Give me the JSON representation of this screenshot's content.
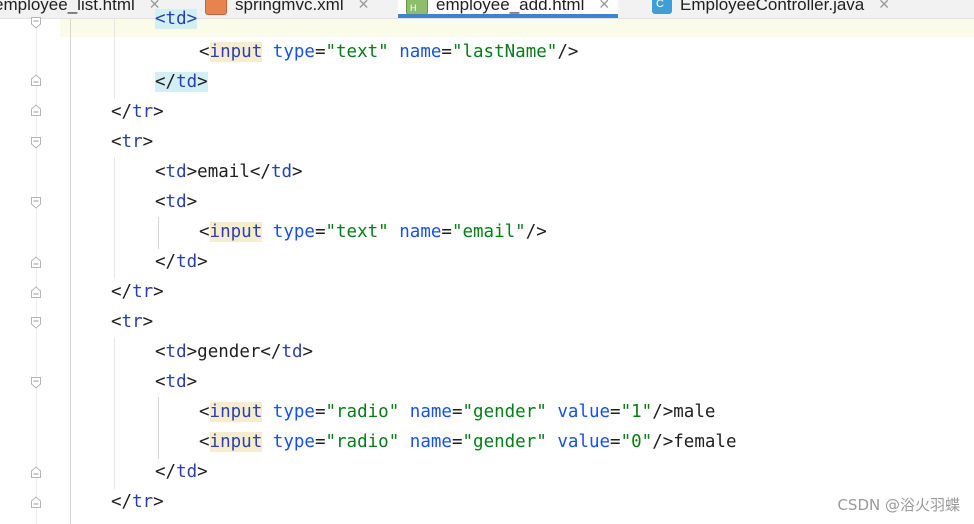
{
  "tabs": [
    {
      "label": "employee_list.html",
      "icon": "html-file-icon",
      "active": false
    },
    {
      "label": "springmvc.xml",
      "icon": "xml-file-icon",
      "active": false
    },
    {
      "label": "employee_add.html",
      "icon": "html-file-icon",
      "active": true
    },
    {
      "label": "EmployeeController.java",
      "icon": "java-class-icon",
      "active": false
    }
  ],
  "code": {
    "l0": {
      "open": "<",
      "tag": "td",
      "close": ">"
    },
    "l1": {
      "open": "<",
      "tag": "input",
      "a1": "type",
      "eq1": "=",
      "v1": "\"text\"",
      "a2": "name",
      "eq2": "=",
      "v2": "\"lastName\"",
      "close": "/>"
    },
    "l2": {
      "open": "</",
      "tag": "td",
      "close": ">"
    },
    "l3": {
      "open": "</",
      "tag": "tr",
      "close": ">"
    },
    "l4": {
      "open": "<",
      "tag": "tr",
      "close": ">"
    },
    "l5": {
      "open": "<",
      "tag": "td",
      "mid": ">",
      "text": "email",
      "open2": "</",
      "tag2": "td",
      "close": ">"
    },
    "l6": {
      "open": "<",
      "tag": "td",
      "close": ">"
    },
    "l7": {
      "open": "<",
      "tag": "input",
      "a1": "type",
      "eq1": "=",
      "v1": "\"text\"",
      "a2": "name",
      "eq2": "=",
      "v2": "\"email\"",
      "close": "/>"
    },
    "l8": {
      "open": "</",
      "tag": "td",
      "close": ">"
    },
    "l9": {
      "open": "</",
      "tag": "tr",
      "close": ">"
    },
    "l10": {
      "open": "<",
      "tag": "tr",
      "close": ">"
    },
    "l11": {
      "open": "<",
      "tag": "td",
      "mid": ">",
      "text": "gender",
      "open2": "</",
      "tag2": "td",
      "close": ">"
    },
    "l12": {
      "open": "<",
      "tag": "td",
      "close": ">"
    },
    "l13": {
      "open": "<",
      "tag": "input",
      "a1": "type",
      "eq1": "=",
      "v1": "\"radio\"",
      "a2": "name",
      "eq2": "=",
      "v2": "\"gender\"",
      "a3": "value",
      "eq3": "=",
      "v3": "\"1\"",
      "close": "/>",
      "text": "male"
    },
    "l14": {
      "open": "<",
      "tag": "input",
      "a1": "type",
      "eq1": "=",
      "v1": "\"radio\"",
      "a2": "name",
      "eq2": "=",
      "v2": "\"gender\"",
      "a3": "value",
      "eq3": "=",
      "v3": "\"0\"",
      "close": "/>",
      "text": "female"
    },
    "l15": {
      "open": "</",
      "tag": "td",
      "close": ">"
    },
    "l16": {
      "open": "</",
      "tag": "tr",
      "close": ">"
    }
  },
  "watermark": "CSDN @浴火羽蝶",
  "colors": {
    "accent_tab": "#4083c9",
    "tag": "#2a3fb0",
    "attr": "#1750eb",
    "value": "#067d17"
  }
}
